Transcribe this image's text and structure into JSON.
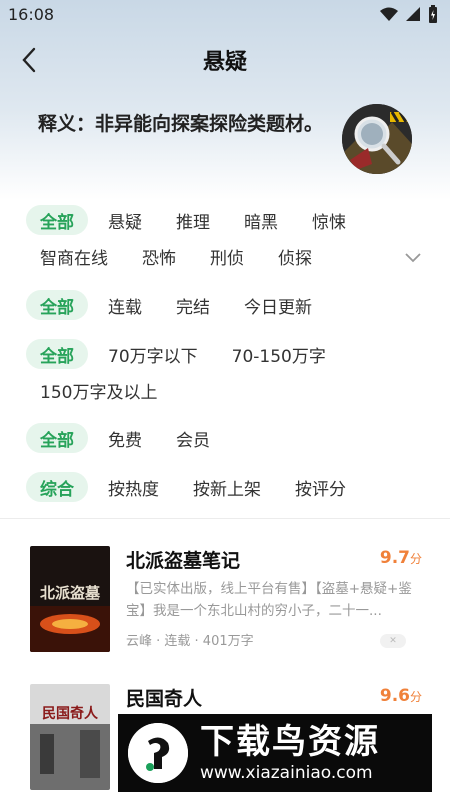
{
  "status": {
    "time": "16:08"
  },
  "nav": {
    "title": "悬疑"
  },
  "definition": "释义：非异能向探案探险类题材。",
  "filters": {
    "category": [
      "全部",
      "悬疑",
      "推理",
      "暗黑",
      "惊悚",
      "智商在线",
      "恐怖",
      "刑侦",
      "侦探"
    ],
    "status": [
      "全部",
      "连载",
      "完结",
      "今日更新"
    ],
    "length": [
      "全部",
      "70万字以下",
      "70-150万字",
      "150万字及以上"
    ],
    "price": [
      "全部",
      "免费",
      "会员"
    ],
    "sort": [
      "综合",
      "按热度",
      "按新上架",
      "按评分"
    ]
  },
  "books": [
    {
      "title": "北派盗墓笔记",
      "score": "9.7",
      "score_unit": "分",
      "desc": "【已实体出版，线上平台有售】【盗墓+悬疑+鉴宝】我是一个东北山村的穷小子，二十一...",
      "meta": "云峰 · 连载 · 401万字",
      "cover_text": "北派盗墓"
    },
    {
      "title": "民国奇人",
      "score": "9.6",
      "score_unit": "分",
      "desc": "",
      "meta": "",
      "cover_text": "民国奇人"
    }
  ],
  "watermark": {
    "title": "下载鸟资源",
    "url": "www.xiazainiao.com"
  },
  "colors": {
    "accent": "#27a35a",
    "chip_bg": "#e6f5ec",
    "score": "#f0813a"
  }
}
